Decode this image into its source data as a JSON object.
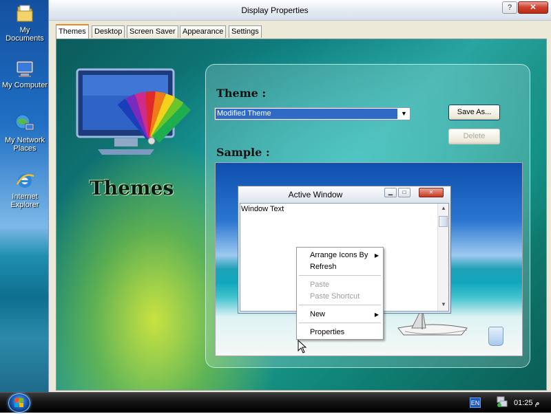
{
  "desktop": {
    "icons": [
      {
        "label": "My Documents"
      },
      {
        "label": "My Computer"
      },
      {
        "label": "My Network Places"
      },
      {
        "label": "Internet Explorer"
      }
    ]
  },
  "dialog": {
    "title": "Display Properties",
    "help_label": "?",
    "close_label": "✕",
    "tabs": [
      {
        "label": "Themes"
      },
      {
        "label": "Desktop"
      },
      {
        "label": "Screen Saver"
      },
      {
        "label": "Appearance"
      },
      {
        "label": "Settings"
      }
    ],
    "brand_word": "Themes",
    "theme_label": "Theme :",
    "theme_value": "Modified Theme",
    "save_as_label": "Save As...",
    "delete_label": "Delete",
    "sample_label": "Sample :"
  },
  "sample": {
    "active_window_title": "Active Window",
    "window_text": "Window Text",
    "context_menu": {
      "items": [
        {
          "label": "Arrange Icons By",
          "submenu": true,
          "enabled": true
        },
        {
          "label": "Refresh",
          "enabled": true
        },
        {
          "label": "Paste",
          "enabled": false
        },
        {
          "label": "Paste Shortcut",
          "enabled": false
        },
        {
          "label": "New",
          "submenu": true,
          "enabled": true
        },
        {
          "label": "Properties",
          "enabled": true
        }
      ]
    }
  },
  "taskbar": {
    "language": "EN",
    "clock": "01:25 م"
  },
  "colors": {
    "selection": "#316ac5",
    "tab_accent": "#e68b2c",
    "close_red": "#c8381f"
  }
}
